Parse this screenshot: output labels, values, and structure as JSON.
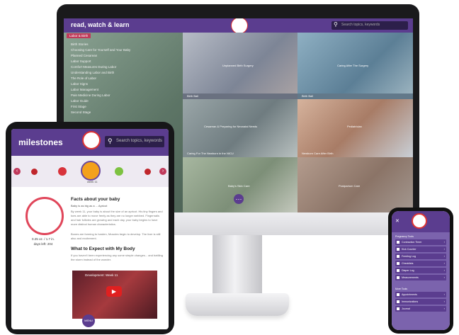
{
  "desktop": {
    "title": "read, watch & learn",
    "search_placeholder": "Search topics, keywords",
    "sidebar": {
      "active": "Labor & Birth",
      "items": [
        "Birth Stories",
        "Choosing Care for Yourself and Your Baby",
        "Planned Cesarean",
        "Labor Support",
        "Comfort Measures During Labor",
        "Understanding Labor and Birth",
        "The Role of Labor",
        "Labor Signs",
        "Labor Management",
        "Pain Medicine During Labor",
        "Labor Guide",
        "First Stage",
        "Second Stage"
      ]
    },
    "tiles": [
      {
        "label": "Unplanned Birth Surgery"
      },
      {
        "label": "Caring After The Surgery"
      },
      {
        "label": "Birth Ball"
      },
      {
        "label": "Birth Ball"
      },
      {
        "label": "Cesarean & Preparing for Neonatal Needs"
      },
      {
        "label": "Pediatrician"
      },
      {
        "label": "Caring For The Newborn in the NICU"
      },
      {
        "label": "Newborn Care After Birth"
      },
      {
        "label": "Baby's Skin Care"
      },
      {
        "label": "Postpartum Care"
      }
    ],
    "fab": "⋯"
  },
  "tablet": {
    "title": "milestones",
    "search_placeholder": "Search topics, keywords",
    "week_label": "week 11",
    "stat_line1": "0.25 oz. / 1.7 in.",
    "stat_line2": "days left: 204",
    "heading1": "Facts about your baby",
    "sub1": "Baby is as big as a ... Apricot",
    "para1a": "By week 11, your baby is about the size of an apricot. His tiny fingers and toes are able to move freely as they are no longer webbed. Fingernails and hair follicles are growing and each day, your baby begins to have more distinct human characteristics.",
    "para1b": "Bones are forming to harden, Muscles begin to develop. The liver is still also and excitement.",
    "heading2": "What to Expect with My Body",
    "para2": "If you haven't been experiencing any some simple changes... and battling the storm instead of the wonder.",
    "video_title": "Development: Week 11",
    "fab": "MENU"
  },
  "phone": {
    "close": "✕",
    "section1": "Pregnancy Tools",
    "items1": [
      "Contraction Timer",
      "Kick Counter",
      "Feeding Log",
      "Checklists",
      "Diaper Log",
      "Measurements"
    ],
    "section2": "More Tools",
    "items2": [
      "Appointments",
      "Immunizations",
      "Journal"
    ]
  },
  "colors": {
    "primary": "#5b3d8f",
    "accent": "#c03a5b",
    "dark": "#2c1f4a"
  }
}
